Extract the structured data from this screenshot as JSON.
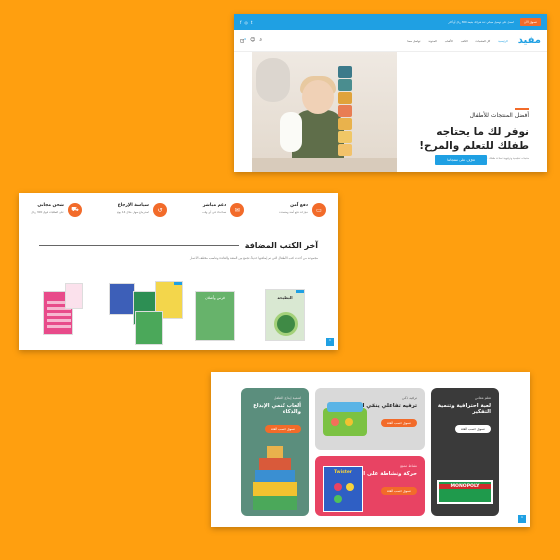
{
  "shot1": {
    "top_bar": {
      "promo_button": "تسوق الآن",
      "notice": "احصل على توصيل مجاني عند شرائك بقيمة 300 ريال أو أكثر",
      "social": [
        "f",
        "◎",
        "t"
      ]
    },
    "nav": {
      "logo": "مفيد",
      "links": [
        "الرئيسية",
        "كل المنتجات",
        "الكتب",
        "الألعاب",
        "المدونة",
        "تواصل معنا"
      ],
      "cart_count": "0"
    },
    "hero": {
      "eyebrow": "أفضل المنتجات للأطفال",
      "title": "نوفر لك ما يحتاجه طفلك للتعلم والمرح!",
      "description": "منتجات تعليمية وترفيهية تساعد طفلك على التعلم والتطور بطريقة ممتعة",
      "cta": "تعرّف على منتجاتنا"
    }
  },
  "shot2": {
    "features": [
      {
        "icon": "card-icon",
        "title": "دفع آمن",
        "sub": "خيارات دفع آمنة ومتعددة"
      },
      {
        "icon": "chat-icon",
        "title": "دعم مباشر",
        "sub": "نساعدك في أي وقت"
      },
      {
        "icon": "return-icon",
        "title": "سياسة الإرجاع",
        "sub": "استرجاع سهل خلال 14 يوم"
      },
      {
        "icon": "truck-icon",
        "title": "شحن مجاني",
        "sub": "على الطلبات فوق 300 ريال"
      }
    ],
    "section_title": "آخر الكتب المضافة",
    "section_desc": "مجموعة من أحدث كتب الأطفال التي تم إضافتها حديثاً، تجمع بين المتعة والفائدة وتناسب مختلف الأعمار",
    "books": [
      {
        "title": "البطيخة",
        "color": "#d9e8d2"
      },
      {
        "title": "فرس وأصلان",
        "color": "#67b36b"
      },
      {
        "title": "الرياضيات",
        "color": "#f3d64b"
      },
      {
        "title": "حروفي",
        "color": "#e84b8a"
      }
    ],
    "scroll_up": "⌃"
  },
  "shot3": {
    "cards": [
      {
        "tag": "تعلم معاني",
        "title": "لعبة احترافية وتنمية التفكير",
        "button": "تسوق حسب الفئة",
        "bg": "#3a3a3a",
        "product": "MONOPOLY"
      },
      {
        "tag": "ترفيه ذكي",
        "title": "ترفيه تفاعلي ينمّي المهارات",
        "button": "تسوق حسب الفئة",
        "bg": "#d9d9d9",
        "product": ""
      },
      {
        "tag": "نشاط ممتع",
        "title": "حركة ونشاطة على الهواء",
        "button": "تسوق حسب الفئة",
        "bg": "#e84363",
        "product": "Twister"
      },
      {
        "tag": "لتنمية إبداع الطفل",
        "title": "ألعاب تُنمي الإبداع والذكاء",
        "button": "تسوق حسب الفئة",
        "bg": "#5b8e7d",
        "product": ""
      }
    ],
    "scroll_up": "⌃"
  }
}
